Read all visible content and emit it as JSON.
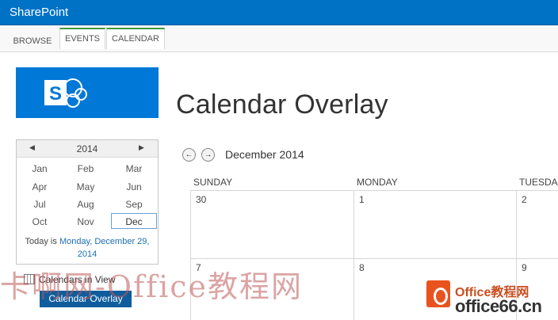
{
  "suite_bar": {
    "brand": "SharePoint"
  },
  "ribbon": {
    "tabs": [
      {
        "label": "BROWSE"
      },
      {
        "label": "EVENTS"
      },
      {
        "label": "CALENDAR"
      }
    ]
  },
  "page": {
    "title": "Calendar Overlay"
  },
  "date_picker": {
    "year": "2014",
    "prev_glyph": "◀",
    "next_glyph": "▶",
    "months": [
      "Jan",
      "Feb",
      "Mar",
      "Apr",
      "May",
      "Jun",
      "Jul",
      "Aug",
      "Sep",
      "Oct",
      "Nov",
      "Dec"
    ],
    "selected_month": "Dec",
    "today_prefix": "Today is ",
    "today_link": "Monday, December 29, 2014"
  },
  "calendars_in_view": {
    "label": "Calendars in View",
    "items": [
      "Calendar Overlay"
    ]
  },
  "calendar": {
    "month_label": "December 2014",
    "prev_glyph": "←",
    "next_glyph": "→",
    "day_headers": [
      "SUNDAY",
      "MONDAY",
      "TUESDA"
    ],
    "week1": [
      "30",
      "1",
      "2"
    ],
    "week2": [
      "7",
      "8",
      "9"
    ]
  },
  "watermark": {
    "text": "卡啊网-Office教程网",
    "brand_top": "Office教程网",
    "brand_bottom": "office66.cn"
  },
  "colors": {
    "suite_bar": "#0072c6",
    "logo_bg": "#0078d7",
    "tab_accent": "#3f9a3f",
    "chip_bg": "#0f5d9c",
    "link": "#1c6fb5"
  }
}
